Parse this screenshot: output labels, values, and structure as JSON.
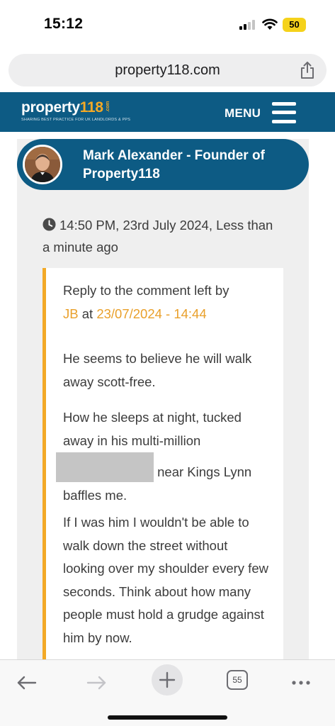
{
  "status_bar": {
    "time": "15:12",
    "battery": "50"
  },
  "browser": {
    "url": "property118.com",
    "tabs_count": "55"
  },
  "site": {
    "logo_text": "property",
    "logo_number": "118",
    "logo_com": ".com",
    "tagline": "SHARING BEST PRACTICE FOR UK LANDLORDS & PPS",
    "menu_label": "MENU"
  },
  "comment": {
    "author": "Mark Alexander - Founder of Property118",
    "timestamp": "14:50 PM, 23rd July 2024, Less than a minute ago",
    "reply_prefix": "Reply to the comment left by",
    "reply_author": "JB",
    "reply_at": "at",
    "reply_datetime": "23/07/2024 - 14:44",
    "paragraph_1": "He seems to believe he will walk away scott-free.",
    "paragraph_2_start": "How he sleeps at night, tucked away in his multi-million",
    "paragraph_2_end": "near Kings Lynn baffles me.",
    "paragraph_3": "If I was him I wouldn't be able to walk down the street without looking over my shoulder every few seconds. Think about how many people must hold a grudge against him by now."
  },
  "colors": {
    "brand_blue": "#0d5b84",
    "accent_orange": "#f3a927"
  }
}
